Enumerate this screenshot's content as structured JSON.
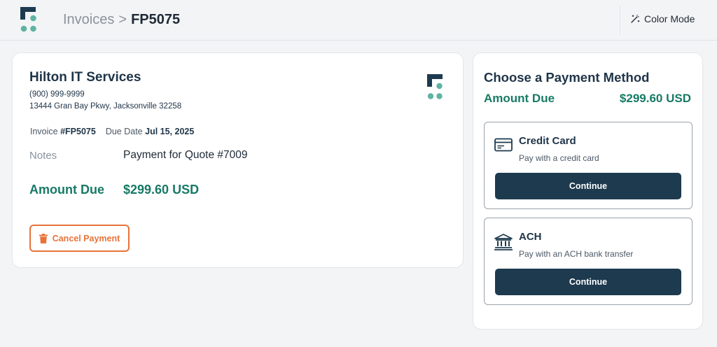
{
  "header": {
    "breadcrumb_parent": "Invoices",
    "breadcrumb_separator": ">",
    "breadcrumb_current": "FP5075",
    "color_mode_label": "Color Mode"
  },
  "invoice": {
    "company_name": "Hilton IT Services",
    "phone": "(900) 999-9999",
    "address": "13444 Gran Bay Pkwy, Jacksonville 32258",
    "invoice_label": "Invoice",
    "invoice_number": "#FP5075",
    "due_date_label": "Due Date",
    "due_date": "Jul 15, 2025",
    "notes_label": "Notes",
    "notes_value": "Payment for Quote #7009",
    "amount_due_label": "Amount Due",
    "amount_due_value": "$299.60 USD",
    "cancel_label": "Cancel Payment"
  },
  "payment": {
    "title": "Choose a Payment Method",
    "amount_due_label": "Amount Due",
    "amount_due_value": "$299.60 USD",
    "methods": [
      {
        "name": "Credit Card",
        "description": "Pay with a credit card",
        "button": "Continue",
        "icon": "credit-card-icon"
      },
      {
        "name": "ACH",
        "description": "Pay with an ACH bank transfer",
        "button": "Continue",
        "icon": "bank-icon"
      }
    ]
  },
  "colors": {
    "brand_dark": "#1d3a4f",
    "brand_teal": "#177a66",
    "logo_teal": "#5fb3a3",
    "cancel_orange": "#e8733a",
    "background": "#f3f4f6"
  }
}
